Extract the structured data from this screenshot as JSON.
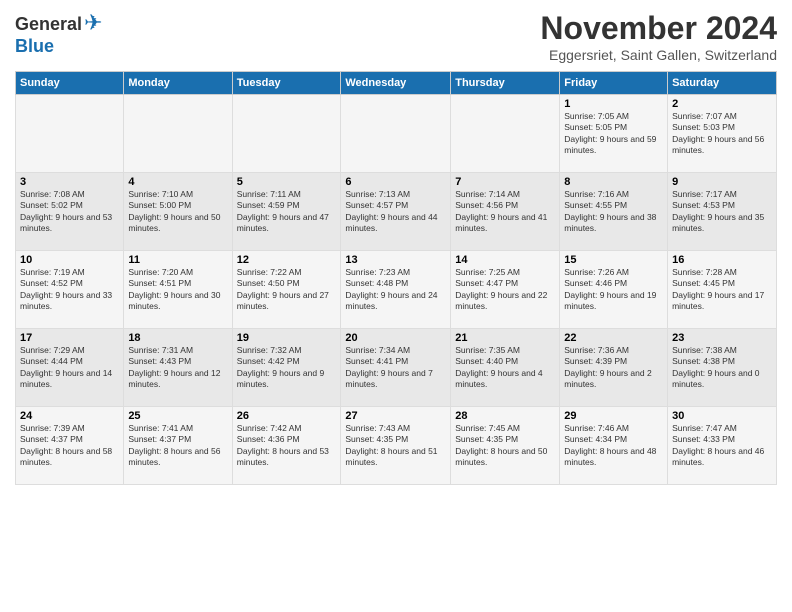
{
  "header": {
    "logo": {
      "general": "General",
      "blue": "Blue"
    },
    "title": "November 2024",
    "subtitle": "Eggersriet, Saint Gallen, Switzerland"
  },
  "weekdays": [
    "Sunday",
    "Monday",
    "Tuesday",
    "Wednesday",
    "Thursday",
    "Friday",
    "Saturday"
  ],
  "weeks": [
    [
      {
        "day": "",
        "info": ""
      },
      {
        "day": "",
        "info": ""
      },
      {
        "day": "",
        "info": ""
      },
      {
        "day": "",
        "info": ""
      },
      {
        "day": "",
        "info": ""
      },
      {
        "day": "1",
        "info": "Sunrise: 7:05 AM\nSunset: 5:05 PM\nDaylight: 9 hours and 59 minutes."
      },
      {
        "day": "2",
        "info": "Sunrise: 7:07 AM\nSunset: 5:03 PM\nDaylight: 9 hours and 56 minutes."
      }
    ],
    [
      {
        "day": "3",
        "info": "Sunrise: 7:08 AM\nSunset: 5:02 PM\nDaylight: 9 hours and 53 minutes."
      },
      {
        "day": "4",
        "info": "Sunrise: 7:10 AM\nSunset: 5:00 PM\nDaylight: 9 hours and 50 minutes."
      },
      {
        "day": "5",
        "info": "Sunrise: 7:11 AM\nSunset: 4:59 PM\nDaylight: 9 hours and 47 minutes."
      },
      {
        "day": "6",
        "info": "Sunrise: 7:13 AM\nSunset: 4:57 PM\nDaylight: 9 hours and 44 minutes."
      },
      {
        "day": "7",
        "info": "Sunrise: 7:14 AM\nSunset: 4:56 PM\nDaylight: 9 hours and 41 minutes."
      },
      {
        "day": "8",
        "info": "Sunrise: 7:16 AM\nSunset: 4:55 PM\nDaylight: 9 hours and 38 minutes."
      },
      {
        "day": "9",
        "info": "Sunrise: 7:17 AM\nSunset: 4:53 PM\nDaylight: 9 hours and 35 minutes."
      }
    ],
    [
      {
        "day": "10",
        "info": "Sunrise: 7:19 AM\nSunset: 4:52 PM\nDaylight: 9 hours and 33 minutes."
      },
      {
        "day": "11",
        "info": "Sunrise: 7:20 AM\nSunset: 4:51 PM\nDaylight: 9 hours and 30 minutes."
      },
      {
        "day": "12",
        "info": "Sunrise: 7:22 AM\nSunset: 4:50 PM\nDaylight: 9 hours and 27 minutes."
      },
      {
        "day": "13",
        "info": "Sunrise: 7:23 AM\nSunset: 4:48 PM\nDaylight: 9 hours and 24 minutes."
      },
      {
        "day": "14",
        "info": "Sunrise: 7:25 AM\nSunset: 4:47 PM\nDaylight: 9 hours and 22 minutes."
      },
      {
        "day": "15",
        "info": "Sunrise: 7:26 AM\nSunset: 4:46 PM\nDaylight: 9 hours and 19 minutes."
      },
      {
        "day": "16",
        "info": "Sunrise: 7:28 AM\nSunset: 4:45 PM\nDaylight: 9 hours and 17 minutes."
      }
    ],
    [
      {
        "day": "17",
        "info": "Sunrise: 7:29 AM\nSunset: 4:44 PM\nDaylight: 9 hours and 14 minutes."
      },
      {
        "day": "18",
        "info": "Sunrise: 7:31 AM\nSunset: 4:43 PM\nDaylight: 9 hours and 12 minutes."
      },
      {
        "day": "19",
        "info": "Sunrise: 7:32 AM\nSunset: 4:42 PM\nDaylight: 9 hours and 9 minutes."
      },
      {
        "day": "20",
        "info": "Sunrise: 7:34 AM\nSunset: 4:41 PM\nDaylight: 9 hours and 7 minutes."
      },
      {
        "day": "21",
        "info": "Sunrise: 7:35 AM\nSunset: 4:40 PM\nDaylight: 9 hours and 4 minutes."
      },
      {
        "day": "22",
        "info": "Sunrise: 7:36 AM\nSunset: 4:39 PM\nDaylight: 9 hours and 2 minutes."
      },
      {
        "day": "23",
        "info": "Sunrise: 7:38 AM\nSunset: 4:38 PM\nDaylight: 9 hours and 0 minutes."
      }
    ],
    [
      {
        "day": "24",
        "info": "Sunrise: 7:39 AM\nSunset: 4:37 PM\nDaylight: 8 hours and 58 minutes."
      },
      {
        "day": "25",
        "info": "Sunrise: 7:41 AM\nSunset: 4:37 PM\nDaylight: 8 hours and 56 minutes."
      },
      {
        "day": "26",
        "info": "Sunrise: 7:42 AM\nSunset: 4:36 PM\nDaylight: 8 hours and 53 minutes."
      },
      {
        "day": "27",
        "info": "Sunrise: 7:43 AM\nSunset: 4:35 PM\nDaylight: 8 hours and 51 minutes."
      },
      {
        "day": "28",
        "info": "Sunrise: 7:45 AM\nSunset: 4:35 PM\nDaylight: 8 hours and 50 minutes."
      },
      {
        "day": "29",
        "info": "Sunrise: 7:46 AM\nSunset: 4:34 PM\nDaylight: 8 hours and 48 minutes."
      },
      {
        "day": "30",
        "info": "Sunrise: 7:47 AM\nSunset: 4:33 PM\nDaylight: 8 hours and 46 minutes."
      }
    ]
  ]
}
